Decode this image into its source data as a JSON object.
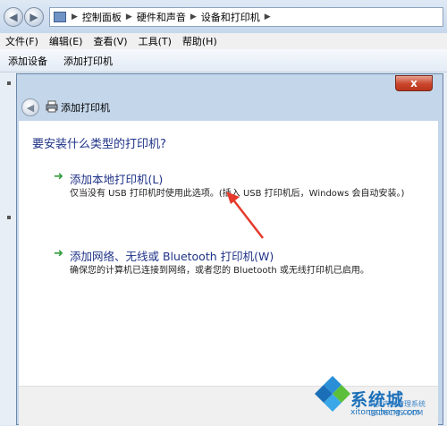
{
  "address_bar": {
    "breadcrumbs": [
      "控制面板",
      "硬件和声音",
      "设备和打印机"
    ]
  },
  "menubar": {
    "items": [
      "文件(F)",
      "编辑(E)",
      "查看(V)",
      "工具(T)",
      "帮助(H)"
    ]
  },
  "toolbar": {
    "add_device": "添加设备",
    "add_printer": "添加打印机"
  },
  "dialog": {
    "title": "添加打印机",
    "close_glyph": "x",
    "question": "要安装什么类型的打印机?",
    "option_local": {
      "title": "添加本地打印机(L)",
      "description": "仅当没有 USB 打印机时使用此选项。(插入 USB 打印机后，Windows 会自动安装。)"
    },
    "option_network": {
      "title": "添加网络、无线或 Bluetooth 打印机(W)",
      "description": "确保您的计算机已连接到网络，或者您的 Bluetooth 或无线打印机已启用。"
    }
  },
  "watermark": {
    "brand": "系统城",
    "site": "xitongcheng.com",
    "overlay": "织梦内容管理系统 DEDECMS.COM"
  },
  "colors": {
    "link_blue": "#1e3287",
    "arrow_green": "#2f9b3a",
    "annotation_red": "#e53a2b",
    "close_red": "#c9452b"
  }
}
